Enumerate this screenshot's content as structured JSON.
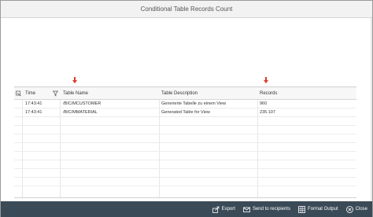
{
  "dialog": {
    "title": "Conditional Table Records Count"
  },
  "table": {
    "columns": [
      {
        "key": "time",
        "label": "Time"
      },
      {
        "key": "table_name",
        "label": "Table Name"
      },
      {
        "key": "table_description",
        "label": "Table Description"
      },
      {
        "key": "records",
        "label": "Records"
      }
    ],
    "rows": [
      {
        "time": "17:43:41",
        "table_name": "/BIC/MCUSTOMER",
        "table_description": "Generierte Tabelle zu einem View",
        "records": "960"
      },
      {
        "time": "17:43:41",
        "table_name": "/BIC/MMATERIAL",
        "table_description": "Generated Table for View",
        "records": "235.107"
      }
    ]
  },
  "footer": {
    "buttons": [
      {
        "name": "export",
        "label": "Export",
        "icon": "export-icon"
      },
      {
        "name": "send-to-recipients",
        "label": "Send to recipients",
        "icon": "envelope-icon"
      },
      {
        "name": "format-output",
        "label": "Format Output",
        "icon": "grid-icon"
      },
      {
        "name": "close",
        "label": "Close",
        "icon": "close-circle-icon"
      }
    ]
  },
  "colors": {
    "footer_bg": "#3b4a57",
    "arrow": "#d83a2e",
    "header_bg": "#f7f7f7"
  }
}
